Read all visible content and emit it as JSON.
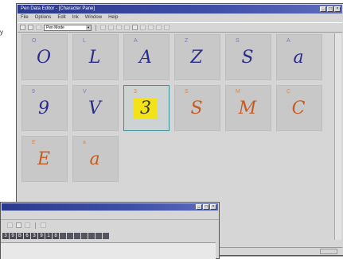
{
  "page": {
    "left_caption": "y"
  },
  "main_window": {
    "title": "Pen Data Editor - [Character Pane]",
    "controls": [
      "_",
      "□",
      "×"
    ],
    "menu": [
      "File",
      "Options",
      "Edit",
      "Ink",
      "Window",
      "Help"
    ],
    "toolbar_select": "Pen Mode",
    "cells": [
      {
        "label": "O",
        "glyph": "O",
        "tone": "blue",
        "selected": false
      },
      {
        "label": "L",
        "glyph": "L",
        "tone": "blue",
        "selected": false
      },
      {
        "label": "A",
        "glyph": "A",
        "tone": "blue",
        "selected": false
      },
      {
        "label": "Z",
        "glyph": "Z",
        "tone": "blue",
        "selected": false
      },
      {
        "label": "S",
        "glyph": "S",
        "tone": "blue",
        "selected": false
      },
      {
        "label": "A",
        "glyph": "a",
        "tone": "blue",
        "selected": false
      },
      {
        "label": "9",
        "glyph": "9",
        "tone": "blue",
        "selected": false
      },
      {
        "label": "V",
        "glyph": "V",
        "tone": "blue",
        "selected": false
      },
      {
        "label": "3",
        "glyph": "3",
        "tone": "highlight",
        "selected": true
      },
      {
        "label": "S",
        "glyph": "S",
        "tone": "orange",
        "selected": false
      },
      {
        "label": "M",
        "glyph": "M",
        "tone": "orange",
        "selected": false
      },
      {
        "label": "C",
        "glyph": "C",
        "tone": "orange",
        "selected": false
      },
      {
        "label": "E",
        "glyph": "E",
        "tone": "orange",
        "selected": false
      },
      {
        "label": "a",
        "glyph": "a",
        "tone": "orange",
        "selected": false
      }
    ]
  },
  "second_window": {
    "title": "",
    "controls": [
      "_",
      "□",
      "×"
    ],
    "strip": [
      "3",
      "9",
      "B",
      "6",
      "3",
      "9",
      "1",
      "8",
      "",
      "",
      "",
      "",
      "",
      "",
      ""
    ]
  },
  "colors": {
    "title_bar": "#2b3a8c",
    "blue_ink": "#2b2b8c",
    "orange_ink": "#c85a22",
    "highlight": "#f2e21a",
    "selection_border": "#3e8f9a"
  }
}
